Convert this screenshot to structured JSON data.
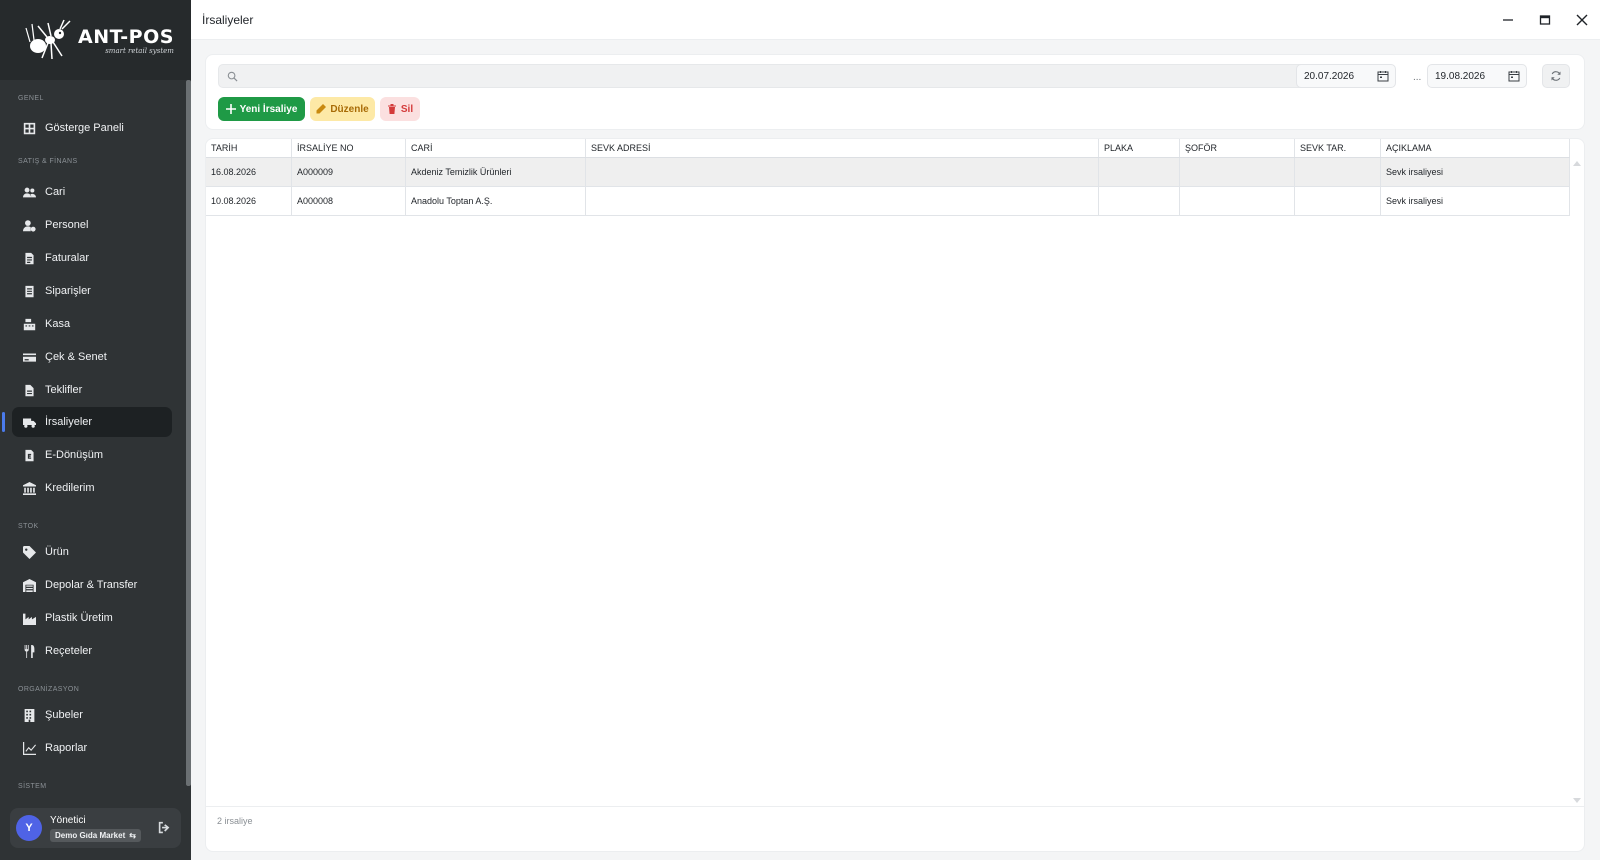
{
  "app": {
    "logo_title": "ANT-POS",
    "logo_subtitle": "smart retail system",
    "window_title": "İrsaliyeler"
  },
  "sidebar": {
    "sections": {
      "genel": "GENEL",
      "satis_finans": "SATIŞ & FİNANS",
      "stok": "STOK",
      "organizasyon": "ORGANİZASYON",
      "sistem": "SİSTEM"
    },
    "items": [
      {
        "label": "Gösterge Paneli",
        "icon": "dashboard-icon"
      },
      {
        "label": "Cari",
        "icon": "users-icon"
      },
      {
        "label": "Personel",
        "icon": "user-cog-icon"
      },
      {
        "label": "Faturalar",
        "icon": "invoice-icon"
      },
      {
        "label": "Siparişler",
        "icon": "order-icon"
      },
      {
        "label": "Kasa",
        "icon": "cash-register-icon"
      },
      {
        "label": "Çek & Senet",
        "icon": "credit-card-icon"
      },
      {
        "label": "Teklifler",
        "icon": "document-icon"
      },
      {
        "label": "İrsaliyeler",
        "icon": "truck-icon",
        "active": true
      },
      {
        "label": "E-Dönüşüm",
        "icon": "e-document-icon"
      },
      {
        "label": "Kredilerim",
        "icon": "bank-icon"
      },
      {
        "label": "Ürün",
        "icon": "tag-icon"
      },
      {
        "label": "Depolar & Transfer",
        "icon": "warehouse-icon"
      },
      {
        "label": "Plastik Üretim",
        "icon": "factory-icon"
      },
      {
        "label": "Reçeteler",
        "icon": "utensils-icon"
      },
      {
        "label": "Şubeler",
        "icon": "building-icon"
      },
      {
        "label": "Raporlar",
        "icon": "chart-line-icon"
      }
    ],
    "user": {
      "initial": "Y",
      "name": "Yönetici",
      "shop": "Demo Gıda Market"
    }
  },
  "toolbar": {
    "search_placeholder": "",
    "date_from": "20.07.2026",
    "date_sep": "...",
    "date_to": "19.08.2026",
    "new_label": "Yeni İrsaliye",
    "edit_label": "Düzenle",
    "delete_label": "Sil"
  },
  "table": {
    "columns": [
      "TARİH",
      "İRSALİYE NO",
      "CARİ",
      "SEVK ADRESİ",
      "PLAKA",
      "ŞOFÖR",
      "SEVK TAR.",
      "AÇIKLAMA"
    ],
    "rows": [
      {
        "tarih": "16.08.2026",
        "no": "A000009",
        "cari": "Akdeniz Temizlik Ürünleri",
        "sevk_adresi": "",
        "plaka": "",
        "sofor": "",
        "sevk_tar": "",
        "aciklama": "Sevk irsaliyesi",
        "selected": true
      },
      {
        "tarih": "10.08.2026",
        "no": "A000008",
        "cari": "Anadolu Toptan A.Ş.",
        "sevk_adresi": "",
        "plaka": "",
        "sofor": "",
        "sevk_tar": "",
        "aciklama": "Sevk irsaliyesi",
        "selected": false
      }
    ],
    "footer": "2 irsaliye"
  },
  "colors": {
    "sidebar_bg": "#2f3335",
    "accent": "#4b7bec",
    "primary_green": "#1f9a46",
    "edit_yellow": "#fde9a6",
    "delete_red": "#d43b3b",
    "avatar": "#4f63e6"
  }
}
